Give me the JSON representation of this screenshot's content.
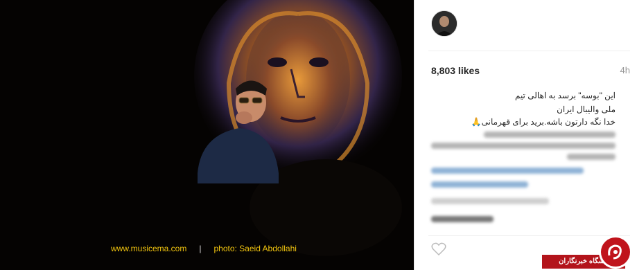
{
  "photo": {
    "credit_site": "www.musicema.com",
    "credit_separator": "|",
    "credit_photo": "photo: Saeid Abdollahi"
  },
  "post": {
    "likes": "8,803 likes",
    "time": "4h",
    "caption_line1": "این \"بوسه\" برسد به اهالی تیم",
    "caption_line2": "ملی والیبال ایران",
    "caption_line3": "خدا نگه دارتون باشه.برید برای قهرمانی🙏"
  },
  "badge": {
    "label": "باشگاه خبرنگاران"
  },
  "colors": {
    "credit": "#f1c40f",
    "badge_red": "#b3141b"
  }
}
